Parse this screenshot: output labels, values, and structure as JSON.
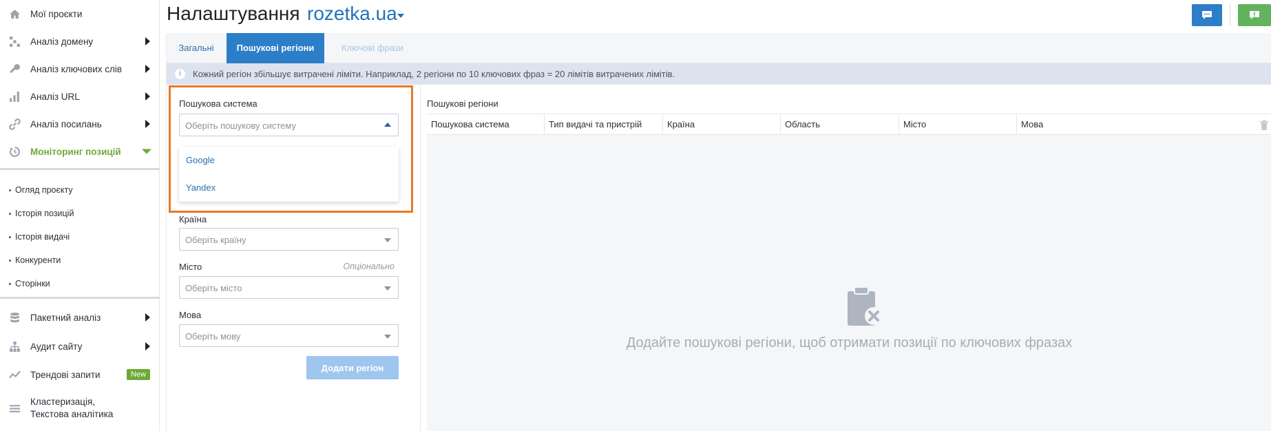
{
  "sidebar": {
    "items": [
      {
        "label": "Мої проєкти",
        "icon": "home-icon"
      },
      {
        "label": "Аналіз домену",
        "icon": "domain-analysis-icon"
      },
      {
        "label": "Аналіз ключових слів",
        "icon": "key-icon"
      },
      {
        "label": "Аналіз URL",
        "icon": "bar-chart-icon"
      },
      {
        "label": "Аналіз посилань",
        "icon": "link-icon"
      },
      {
        "label": "Моніторинг позицій",
        "icon": "history-icon"
      }
    ],
    "sub_items": [
      {
        "label": "Огляд проєкту"
      },
      {
        "label": "Історія позицій"
      },
      {
        "label": "Історія видачі"
      },
      {
        "label": "Конкуренти"
      },
      {
        "label": "Сторінки"
      }
    ],
    "items_bottom": [
      {
        "label": "Пакетний аналіз",
        "icon": "database-icon"
      },
      {
        "label": "Аудит сайту",
        "icon": "sitemap-icon"
      },
      {
        "label": "Трендові запити",
        "icon": "trend-icon",
        "badge": "New"
      },
      {
        "label": "Кластеризація,",
        "label2": "Текстова аналітика",
        "icon": "cluster-icon"
      }
    ]
  },
  "header": {
    "title": "Налаштування",
    "project": "rozetka.ua"
  },
  "tabs": [
    {
      "label": "Загальні"
    },
    {
      "label": "Пошукові регіони"
    },
    {
      "label": "Ключові фрази"
    }
  ],
  "info": {
    "text": "Кожний регіон збільшує витрачені ліміти. Наприклад, 2 регіони по 10 ключових фраз = 20 лімітів витрачених лімітів."
  },
  "form": {
    "search_engine": {
      "label": "Пошукова система",
      "placeholder": "Оберіть пошукову систему",
      "options": [
        "Google",
        "Yandex"
      ]
    },
    "country": {
      "label": "Країна",
      "placeholder": "Оберіть країну"
    },
    "city": {
      "label": "Місто",
      "placeholder": "Оберіть місто",
      "optional": "Опціонально"
    },
    "language": {
      "label": "Мова",
      "placeholder": "Оберіть мову"
    },
    "add_button": "Додати регіон"
  },
  "regions": {
    "title": "Пошукові регіони",
    "columns": [
      "Пошукова система",
      "Тип видачі та пристрій",
      "Країна",
      "Область",
      "Місто",
      "Мова"
    ],
    "empty_text": "Додайте пошукові регіони, щоб отримати позиції по ключових фразах"
  },
  "colors": {
    "accent_blue": "#2c7ec9",
    "accent_green": "#6fa838",
    "highlight": "#e67a26"
  }
}
